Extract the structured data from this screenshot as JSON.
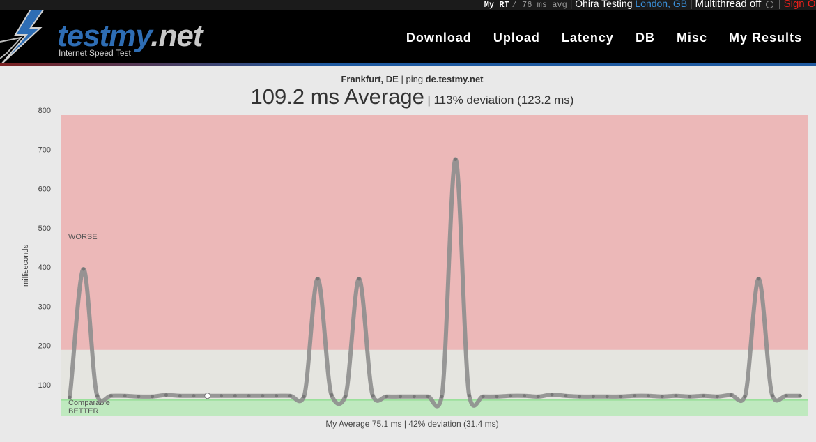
{
  "topbar": {
    "rt_label": "My RT",
    "rt_value": "/ 76 ms avg",
    "user": "Ohira Testing",
    "location": "London, GB",
    "multithread": "Multithread off",
    "signout": "Sign Out"
  },
  "header": {
    "logo_main": "testmy",
    "logo_tld": ".net",
    "tagline": "Internet Speed Test",
    "nav": [
      "Download",
      "Upload",
      "Latency",
      "DB",
      "Misc",
      "My Results"
    ]
  },
  "colors": {
    "worse_zone": "#ecb8b8",
    "comparable_zone": "#e5e5e0",
    "better_zone": "#bfe9bf",
    "line": "#8e8e8e",
    "accent_blue": "#2e6db4",
    "signout_red": "#e8201c"
  },
  "chart_data": {
    "type": "line",
    "location": "Frankfurt, DE",
    "ping_prefix": "ping",
    "host": "de.testmy.net",
    "average_value": "109.2 ms Average",
    "deviation_text": "| 113% deviation (123.2 ms)",
    "footer": "My Average 75.1 ms | 42% deviation (31.4 ms)",
    "ylabel": "milliseconds",
    "ylim": [
      0,
      800
    ],
    "yticks": [
      100,
      200,
      300,
      400,
      500,
      600,
      700,
      800
    ],
    "grid": false,
    "zones": [
      {
        "label": "WORSE",
        "from": 189,
        "to": 800
      },
      {
        "label": "Comparable",
        "from": 60,
        "to": 189
      },
      {
        "label": "BETTER",
        "from": 0,
        "to": 60
      }
    ],
    "series": [
      {
        "values": [
          68,
          395,
          72,
          72,
          72,
          70,
          70,
          74,
          72,
          72,
          72,
          72,
          72,
          72,
          72,
          72,
          72,
          70,
          370,
          74,
          70,
          370,
          72,
          70,
          70,
          70,
          70,
          70,
          675,
          72,
          70,
          70,
          72,
          72,
          70,
          75,
          72,
          70,
          70,
          70,
          70,
          72,
          72,
          70,
          72,
          70,
          72,
          70,
          74,
          70,
          370,
          72,
          72,
          72
        ]
      }
    ]
  }
}
